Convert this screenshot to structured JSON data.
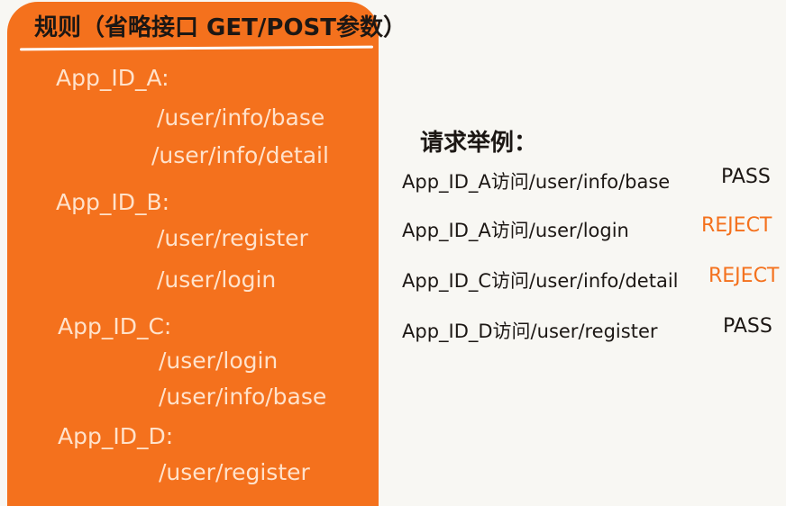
{
  "rules": {
    "title": "规则（省略接口 GET/POST参数）",
    "groups": [
      {
        "app": "App_ID_A:",
        "paths": [
          "/user/info/base",
          "/user/info/detail"
        ]
      },
      {
        "app": "App_ID_B:",
        "paths": [
          "/user/register",
          "/user/login"
        ]
      },
      {
        "app": "App_ID_C:",
        "paths": [
          "/user/login",
          "/user/info/base"
        ]
      },
      {
        "app": "App_ID_D:",
        "paths": [
          "/user/register"
        ]
      }
    ]
  },
  "examples": {
    "heading": "请求举例：",
    "items": [
      {
        "request": "App_ID_A访问/user/info/base",
        "result": "PASS"
      },
      {
        "request": "App_ID_A访问/user/login",
        "result": "REJECT"
      },
      {
        "request": "App_ID_C访问/user/info/detail",
        "result": "REJECT"
      },
      {
        "request": "App_ID_D访问/user/register",
        "result": "PASS"
      }
    ]
  },
  "colors": {
    "card": "#f4711d",
    "card_text": "#ffe2cb",
    "ink": "#1c1714",
    "reject": "#f4711d",
    "pass": "#1c1714",
    "background": "#f8f7f3"
  }
}
